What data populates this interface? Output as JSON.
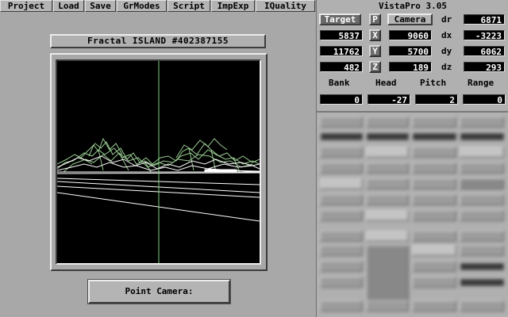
{
  "menu": [
    {
      "id": "project",
      "label": "Project"
    },
    {
      "id": "load",
      "label": "Load"
    },
    {
      "id": "save",
      "label": "Save"
    },
    {
      "id": "grmodes",
      "label": "GrModes"
    },
    {
      "id": "script",
      "label": "Script"
    },
    {
      "id": "impexp",
      "label": "ImpExp"
    },
    {
      "id": "iquality",
      "label": "IQuality"
    }
  ],
  "landscape_name": "Fractal ISLAND #402387155",
  "point_camera_label": "Point Camera:",
  "app_title": "VistaPro 3.05",
  "target_button": "Target",
  "p_button": "P",
  "camera_button": "Camera",
  "labels": {
    "dr": "dr",
    "dx": "dx",
    "dy": "dy",
    "dz": "dz",
    "bank": "Bank",
    "head": "Head",
    "pitch": "Pitch",
    "range": "Range",
    "x": "X",
    "y": "Y",
    "z": "Z"
  },
  "values": {
    "target_x": "5837",
    "target_y": "11762",
    "target_z": "482",
    "camera_x": "9060",
    "camera_y": "5700",
    "camera_z": "189",
    "dr": "6871",
    "dx": "-3223",
    "dy": "6062",
    "dz": "293",
    "bank": "0",
    "head": "-27",
    "pitch": "2",
    "range": "0"
  },
  "colors": {
    "highlight_button": "#6a6a6a",
    "value_box": "#000000",
    "wireframe_near": "#ffffff",
    "wireframe_far": "#a8e0a0",
    "center_line": "#7fd07f"
  }
}
